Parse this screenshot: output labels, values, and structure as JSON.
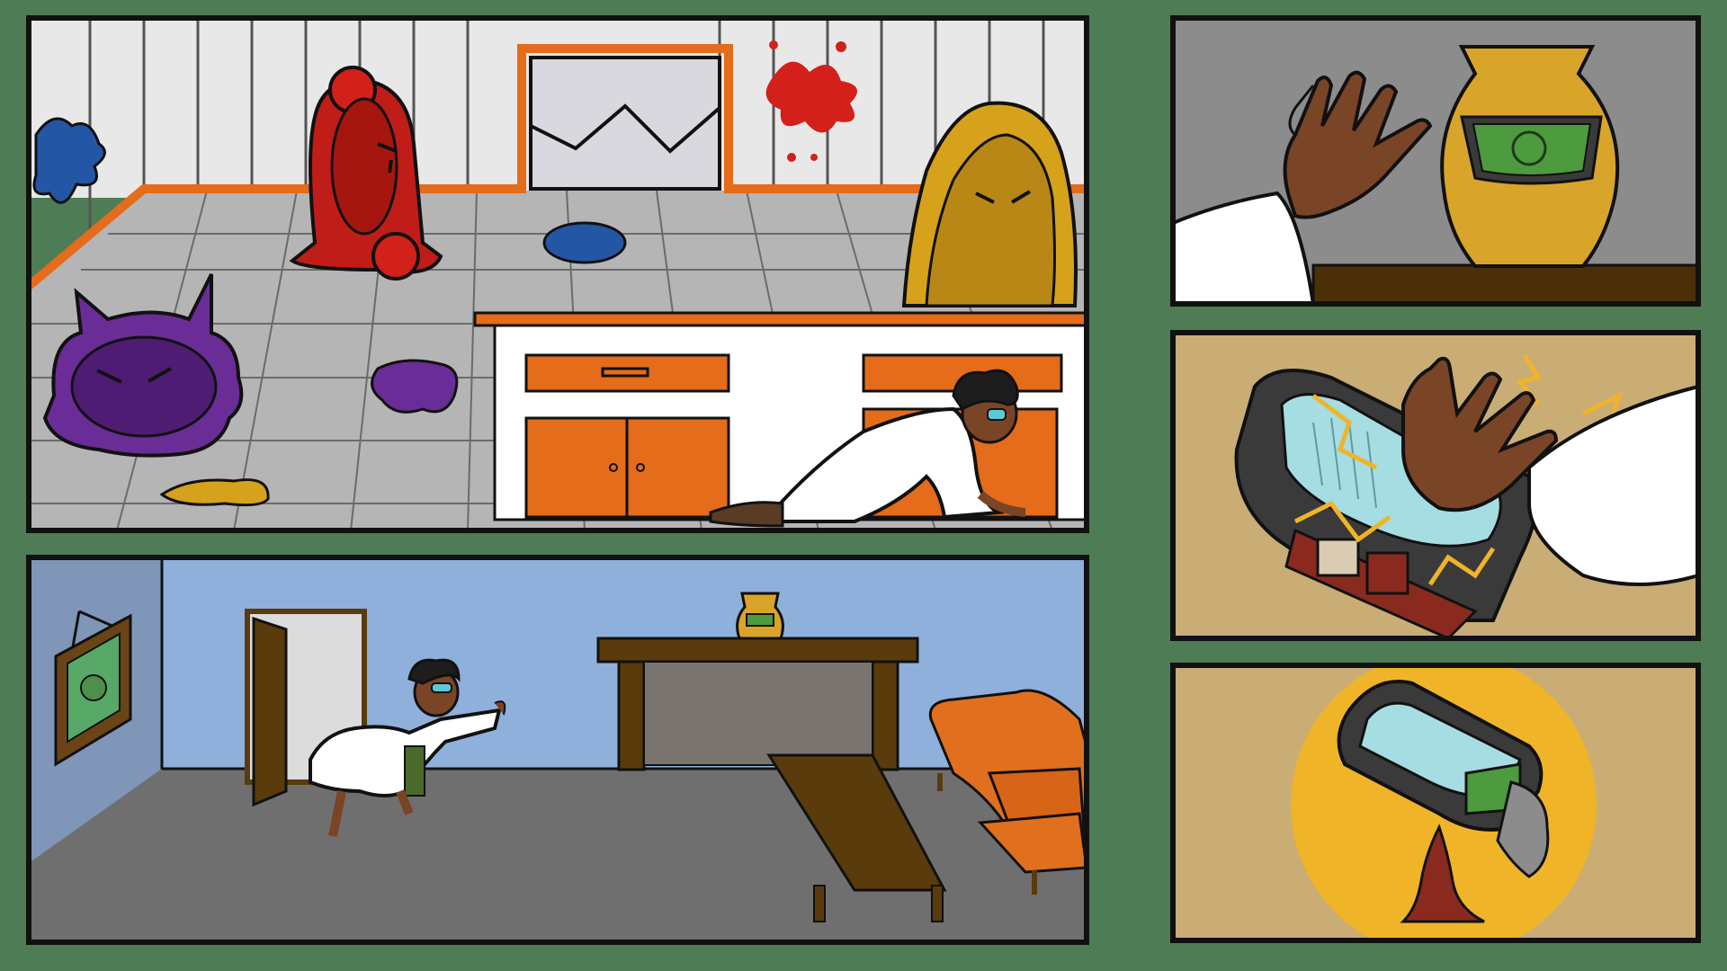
{
  "page": {
    "kind": "comic-page",
    "panel_count": 5
  },
  "palette": {
    "background": "#4e7d55",
    "panel_border": "#111111",
    "orange": "#e46c1a",
    "red_slime": "#c01d18",
    "yellow_slime": "#d6a21b",
    "purple_slime": "#6a2c96",
    "blue_splat": "#2456a6",
    "lab_wall": "#e8e8e8",
    "lab_floor": "#b5b5b5",
    "room_wall": "#8fb0da",
    "room_floor": "#6f6f6f",
    "skin": "#7a4426",
    "coat": "#ffffff",
    "vase_gold": "#d9a42a",
    "tan_bg": "#c9ad74",
    "glow_yellow": "#f0b429",
    "screen_green": "#4e9a3e",
    "sofa_orange": "#e0701e",
    "wood_dark": "#5a3b0c"
  },
  "panels": [
    {
      "id": "lab",
      "label": "lab-room-with-slimes"
    },
    {
      "id": "living",
      "label": "living-room-scientist-running"
    },
    {
      "id": "reach",
      "label": "hand-reaching-vase"
    },
    {
      "id": "zap",
      "label": "hand-grabbing-device-sparks"
    },
    {
      "id": "pour",
      "label": "device-pouring-liquid"
    }
  ],
  "text": {}
}
